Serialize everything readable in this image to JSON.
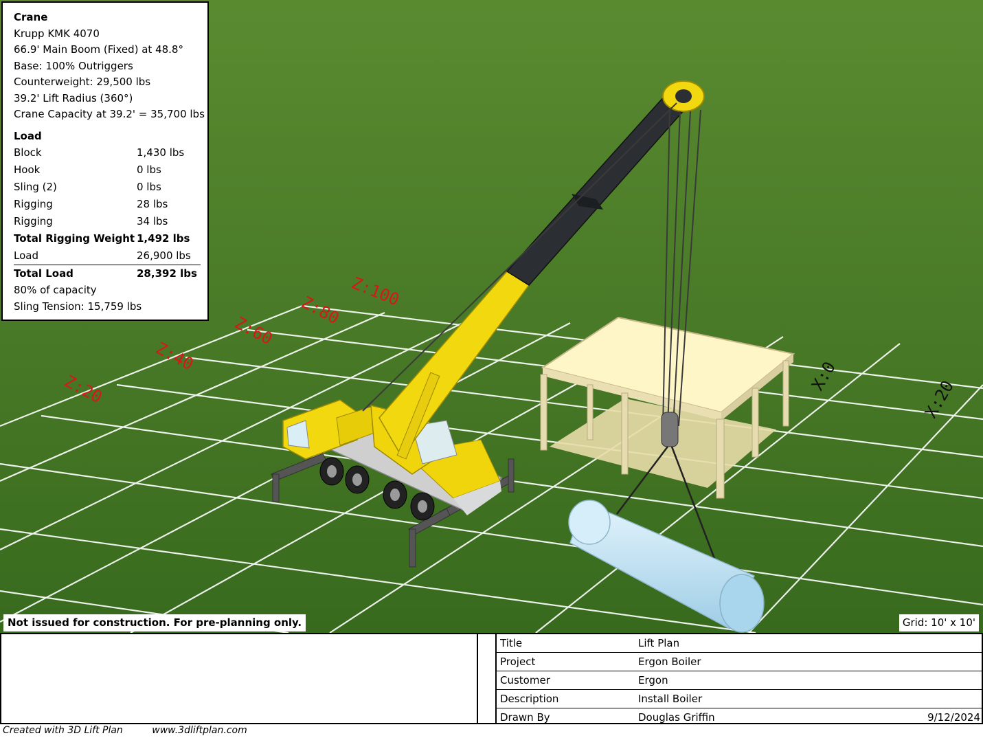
{
  "crane_panel": {
    "heading": "Crane",
    "model": "Krupp KMK 4070",
    "boom": "66.9' Main Boom (Fixed) at 48.8°",
    "base": "Base: 100% Outriggers",
    "counterweight": "Counterweight: 29,500 lbs",
    "radius": "39.2' Lift Radius (360°)",
    "capacity": "Crane Capacity at 39.2' = 35,700 lbs",
    "load_heading": "Load",
    "load_rows": [
      {
        "label": "Block",
        "value": "1,430 lbs"
      },
      {
        "label": "Hook",
        "value": "0 lbs"
      },
      {
        "label": "Sling (2)",
        "value": "0 lbs"
      },
      {
        "label": "Rigging",
        "value": "28 lbs"
      },
      {
        "label": "Rigging",
        "value": "34 lbs"
      },
      {
        "label": "Total Rigging Weight",
        "value": "1,492 lbs"
      },
      {
        "label": "Load",
        "value": "26,900 lbs"
      },
      {
        "label": "Total Load",
        "value": "28,392 lbs"
      }
    ],
    "percent_capacity": "80% of capacity",
    "sling_tension": "Sling Tension: 15,759 lbs"
  },
  "scene": {
    "grid_labels": [
      "Z:20",
      "Z:40",
      "Z:60",
      "Z:80",
      "Z:100",
      "X:0",
      "X:20"
    ],
    "ground_color": "#3f6e22",
    "crane_color": "#e8cc10",
    "load_color": "#bfe3f5"
  },
  "banner": "Not issued for construction. For pre-planning only.",
  "grid_size": "Grid: 10' x 10'",
  "title_block": {
    "rows": [
      {
        "label": "Title",
        "value": "Lift Plan"
      },
      {
        "label": "Project",
        "value": "Ergon Boiler"
      },
      {
        "label": "Customer",
        "value": "Ergon"
      },
      {
        "label": "Description",
        "value": "Install Boiler"
      },
      {
        "label": "Drawn By",
        "value": "Douglas Griffin",
        "date": "9/12/2024"
      }
    ]
  },
  "footer": {
    "created": "Created with 3D Lift Plan",
    "website": "www.3dliftplan.com"
  }
}
